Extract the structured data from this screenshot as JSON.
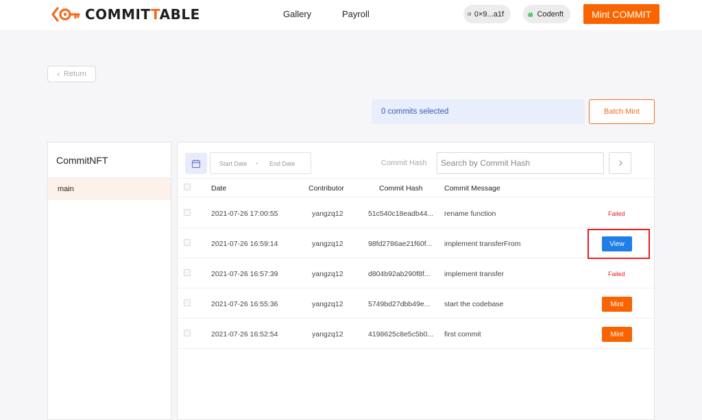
{
  "header": {
    "logo_prefix": "COMMIT",
    "logo_middle": "T",
    "logo_suffix": "ABLE",
    "nav": [
      "Gallery",
      "Payroll"
    ],
    "wallet": "0×9...a1f",
    "account": "Codenft",
    "mint_commit": "Mint COMMIT",
    "colors": {
      "brand": "#f26b1d",
      "button": "#fa6400"
    }
  },
  "return_label": "Return",
  "selection": {
    "text": "0 commits selected",
    "batch_mint": "Batch Mint"
  },
  "sidebar": {
    "title": "CommitNFT",
    "branches": [
      "main"
    ]
  },
  "filters": {
    "start_placeholder": "Start Date",
    "separator": "-",
    "end_placeholder": "End Date",
    "hash_label": "Commit Hash",
    "hash_placeholder": "Search by Commit Hash"
  },
  "table": {
    "columns": [
      "Date",
      "Contributor",
      "Commit Hash",
      "Commit Message"
    ],
    "rows": [
      {
        "date": "2021-07-26 17:00:55",
        "contributor": "yangzq12",
        "hash": "51c540c18eadb44...",
        "message": "rename function",
        "status": "Failed"
      },
      {
        "date": "2021-07-26 16:59:14",
        "contributor": "yangzq12",
        "hash": "98fd2786ae21f60f...",
        "message": "implement transferFrom",
        "status": "View"
      },
      {
        "date": "2021-07-26 16:57:39",
        "contributor": "yangzq12",
        "hash": "d804b92ab290f8f...",
        "message": "implement transfer",
        "status": "Failed"
      },
      {
        "date": "2021-07-26 16:55:36",
        "contributor": "yangzq12",
        "hash": "5749bd27dbb49e...",
        "message": "start the codebase",
        "status": "Mint"
      },
      {
        "date": "2021-07-26 16:52:54",
        "contributor": "yangzq12",
        "hash": "4198625c8e5c5b0...",
        "message": "first commit",
        "status": "Mint"
      }
    ],
    "icons": [
      "calendar-icon",
      "chevron-right-icon",
      "wallet-icon",
      "robot-icon",
      "chevron-left-icon"
    ]
  }
}
